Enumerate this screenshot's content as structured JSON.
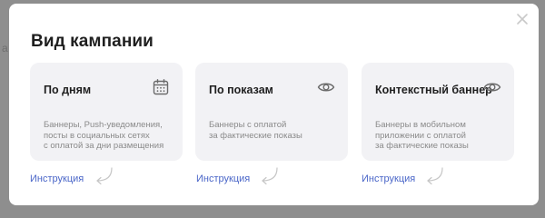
{
  "modal": {
    "title": "Вид кампании",
    "cards": [
      {
        "title": "По дням",
        "icon": "calendar-icon",
        "description_lines": [
          "Баннеры, Push-уведомления,",
          "посты в социальных сетях",
          "с оплатой за дни размещения"
        ],
        "instruction_link": "Инструкция"
      },
      {
        "title": "По показам",
        "icon": "eye-icon",
        "description_lines": [
          "Баннеры с оплатой",
          "за фактические показы"
        ],
        "instruction_link": "Инструкция"
      },
      {
        "title": "Контекстный баннер",
        "icon": "eye-icon",
        "description_lines": [
          "Баннеры в мобильном",
          "приложении с оплатой",
          "за фактические показы"
        ],
        "instruction_link": "Инструкция"
      }
    ]
  },
  "colors": {
    "overlay": "#8e8e8e",
    "card_bg": "#f2f2f5",
    "link": "#4a66c8",
    "title": "#1f1f1f",
    "desc": "#8a8a8a"
  }
}
